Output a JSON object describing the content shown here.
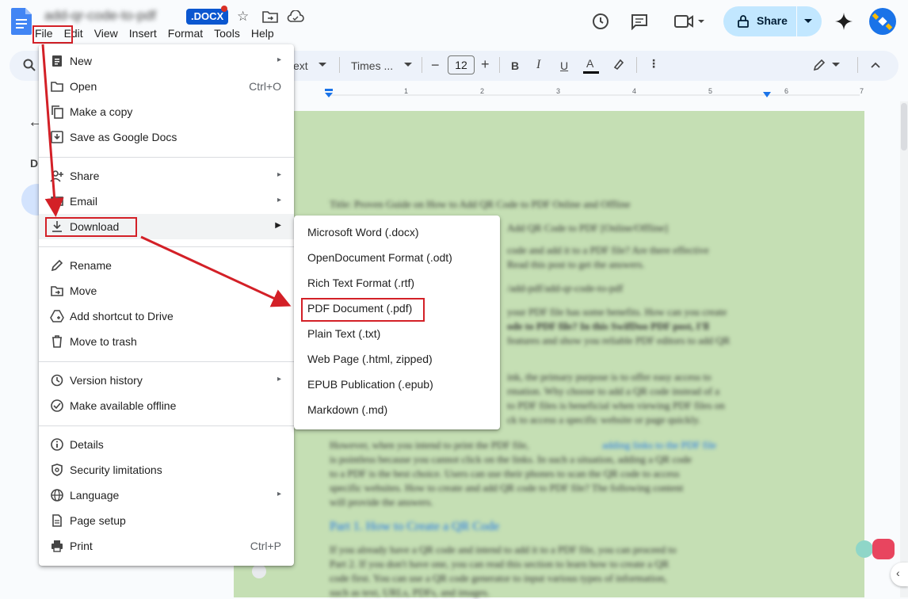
{
  "doc": {
    "title": "add-qr-code-to-pdf",
    "badge": ".DOCX"
  },
  "menubar": [
    "File",
    "Edit",
    "View",
    "Insert",
    "Format",
    "Tools",
    "Help"
  ],
  "share": {
    "label": "Share"
  },
  "toolbar": {
    "style_label": "ext",
    "font_label": "Times ...",
    "font_size": "12"
  },
  "ruler": [
    "1",
    "2",
    "3",
    "4",
    "5",
    "6",
    "7"
  ],
  "left_panel": {
    "heading_initial": "D"
  },
  "file_menu": {
    "items": [
      {
        "label": "New",
        "icon": "doc-icon",
        "arrow": true
      },
      {
        "label": "Open",
        "icon": "folder-icon",
        "shortcut": "Ctrl+O"
      },
      {
        "label": "Make a copy",
        "icon": "copy-icon"
      },
      {
        "label": "Save as Google Docs",
        "icon": "save-icon"
      },
      {
        "label": "Share",
        "icon": "person-add-icon",
        "arrow": true
      },
      {
        "label": "Email",
        "icon": "mail-icon",
        "arrow": true
      },
      {
        "label": "Download",
        "icon": "download-icon",
        "arrow": true
      },
      {
        "label": "Rename",
        "icon": "pencil-icon"
      },
      {
        "label": "Move",
        "icon": "move-folder-icon"
      },
      {
        "label": "Add shortcut to Drive",
        "icon": "drive-shortcut-icon"
      },
      {
        "label": "Move to trash",
        "icon": "trash-icon"
      },
      {
        "label": "Version history",
        "icon": "history-icon",
        "arrow": true
      },
      {
        "label": "Make available offline",
        "icon": "offline-check-icon"
      },
      {
        "label": "Details",
        "icon": "info-icon"
      },
      {
        "label": "Security limitations",
        "icon": "shield-icon"
      },
      {
        "label": "Language",
        "icon": "globe-icon",
        "arrow": true
      },
      {
        "label": "Page setup",
        "icon": "page-icon"
      },
      {
        "label": "Print",
        "icon": "printer-icon",
        "shortcut": "Ctrl+P"
      }
    ]
  },
  "download_menu": {
    "items": [
      "Microsoft Word (.docx)",
      "OpenDocument Format (.odt)",
      "Rich Text Format (.rtf)",
      "PDF Document (.pdf)",
      "Plain Text (.txt)",
      "Web Page (.html, zipped)",
      "EPUB Publication (.epub)",
      "Markdown (.md)"
    ]
  },
  "document_lines": [
    "Title: Proven Guide on How to Add QR Code to PDF Online and Offline",
    "Add QR Code to PDF [Online/Offline]",
    "code and add it to a PDF file? Are there effective",
    "Read this post to get the answers.",
    "/add-pdf/add-qr-code-to-pdf",
    "your PDF file has some benefits. How can you create",
    "ode to PDF file? In this SwifDoo PDF post, I'll",
    "features and show you reliable PDF editors to add QR",
    "ink, the primary purpose is to offer easy access to",
    "rmation. Why choose to add a QR code instead of a",
    "to PDF files is beneficial when viewing PDF files on",
    "ck to access a specific website or page quickly.",
    "However, when you intend to print the PDF file,",
    "adding links to the PDF file",
    "is pointless because you cannot click on the links. In such a situation, adding a QR code",
    "to a PDF is the best choice. Users can use their phones to scan the QR code to access",
    "specific websites. How to create and add QR code to PDF file? The following content",
    "will provide the answers.",
    "Part 1. How to Create a QR Code",
    "If you already have a QR code and intend to add it to a PDF file, you can proceed to",
    "Part 2. If you don't have one, you can read this section to learn how to create a QR",
    "code first. You can use a QR code generator to input various types of information,",
    "such as text, URLs, PDFs, and images."
  ],
  "colors": {
    "page_bg": "#c5dfb4",
    "annotation_red": "#d32027",
    "share_bg": "#c2e7ff",
    "badge_blue": "#0b57d0"
  }
}
